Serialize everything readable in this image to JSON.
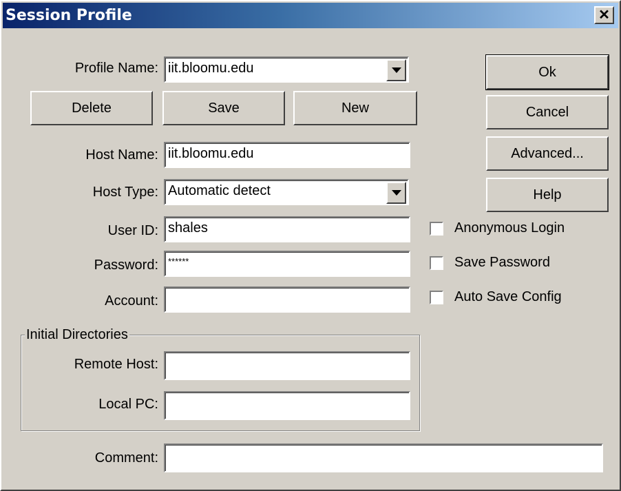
{
  "window": {
    "title": "Session Profile",
    "close_symbol": "✕"
  },
  "fields": {
    "profile_name": {
      "label": "Profile Name:",
      "value": "iit.bloomu.edu"
    },
    "host_name": {
      "label": "Host Name:",
      "value": "iit.bloomu.edu"
    },
    "host_type": {
      "label": "Host Type:",
      "value": "Automatic detect"
    },
    "user_id": {
      "label": "User ID:",
      "value": "shales"
    },
    "password": {
      "label": "Password:",
      "value": "******"
    },
    "account": {
      "label": "Account:",
      "value": ""
    },
    "remote_host": {
      "label": "Remote Host:",
      "value": ""
    },
    "local_pc": {
      "label": "Local PC:",
      "value": ""
    },
    "comment": {
      "label": "Comment:",
      "value": ""
    }
  },
  "group": {
    "initial_directories": "Initial Directories"
  },
  "buttons": {
    "delete": "Delete",
    "save": "Save",
    "new": "New",
    "ok": "Ok",
    "cancel": "Cancel",
    "advanced": "Advanced...",
    "help": "Help"
  },
  "checkboxes": {
    "anonymous_login": {
      "label": "Anonymous Login",
      "checked": false
    },
    "save_password": {
      "label": "Save Password",
      "checked": false
    },
    "auto_save_config": {
      "label": "Auto Save Config",
      "checked": false
    }
  },
  "colors": {
    "face": "#d4d0c8",
    "title_start": "#0a246a",
    "title_end": "#a6caf0"
  }
}
